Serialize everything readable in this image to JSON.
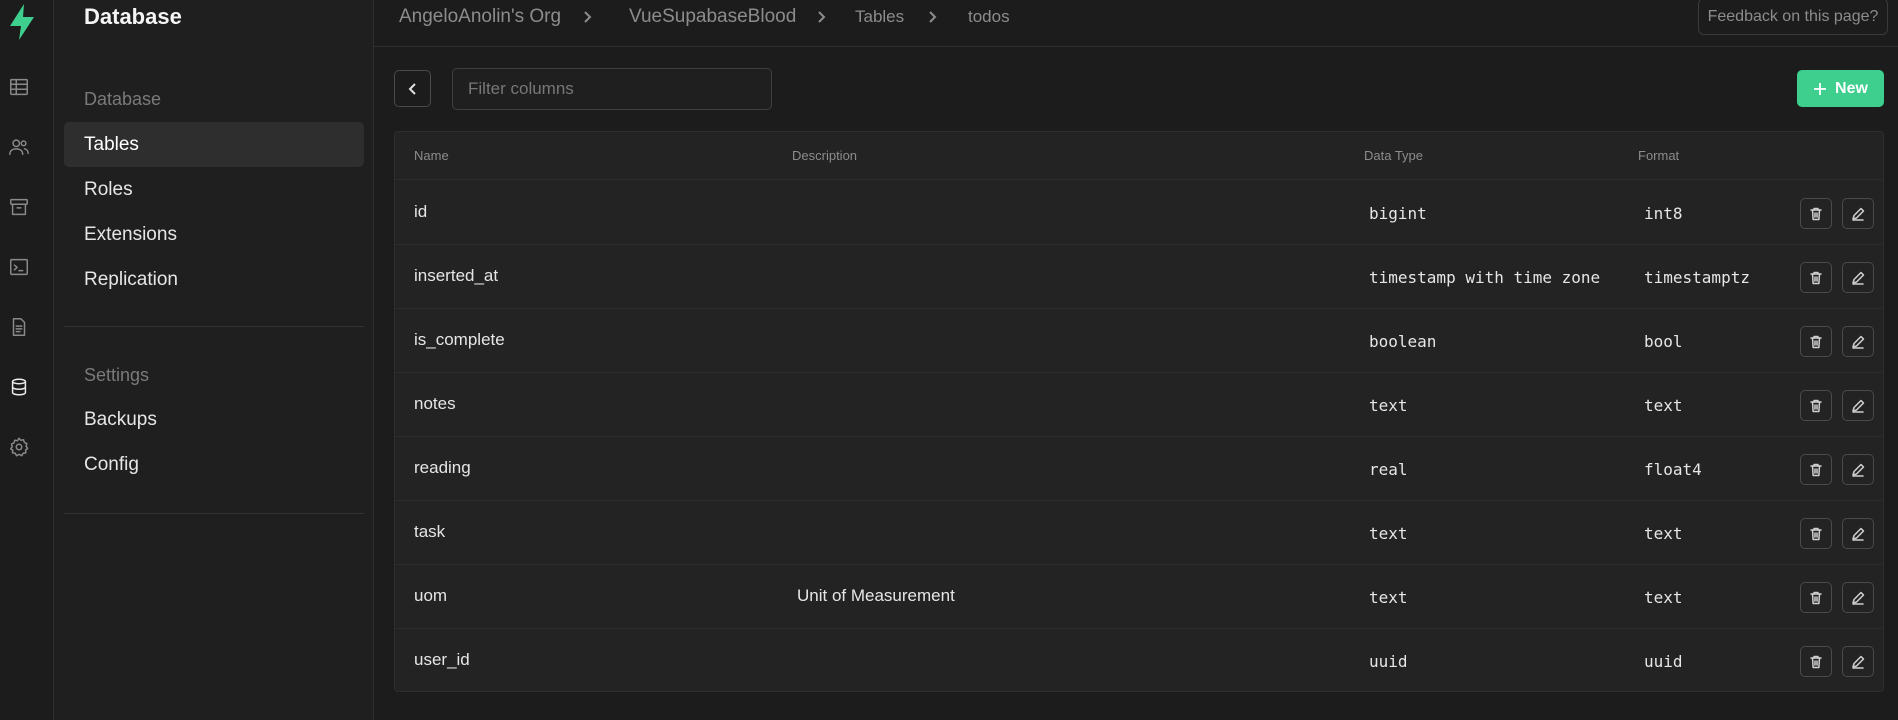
{
  "sidebar": {
    "title": "Database",
    "sections": [
      {
        "heading": "Database",
        "items": [
          "Tables",
          "Roles",
          "Extensions",
          "Replication"
        ]
      },
      {
        "heading": "Settings",
        "items": [
          "Backups",
          "Config"
        ]
      }
    ]
  },
  "breadcrumb": {
    "org": "AngeloAnolin's Org",
    "project": "VueSupabaseBlood",
    "section": "Tables",
    "table": "todos"
  },
  "feedback_label": "Feedback on this page?",
  "toolbar": {
    "filter_placeholder": "Filter columns",
    "new_label": "New"
  },
  "table": {
    "headers": [
      "Name",
      "Description",
      "Data Type",
      "Format"
    ],
    "rows": [
      {
        "name": "id",
        "description": "",
        "type": "bigint",
        "format": "int8"
      },
      {
        "name": "inserted_at",
        "description": "",
        "type": "timestamp with time zone",
        "format": "timestamptz"
      },
      {
        "name": "is_complete",
        "description": "",
        "type": "boolean",
        "format": "bool"
      },
      {
        "name": "notes",
        "description": "",
        "type": "text",
        "format": "text"
      },
      {
        "name": "reading",
        "description": "",
        "type": "real",
        "format": "float4"
      },
      {
        "name": "task",
        "description": "",
        "type": "text",
        "format": "text"
      },
      {
        "name": "uom",
        "description": "Unit of Measurement",
        "type": "text",
        "format": "text"
      },
      {
        "name": "user_id",
        "description": "",
        "type": "uuid",
        "format": "uuid"
      }
    ]
  },
  "colors": {
    "brand": "#3ecf8e",
    "background": "#1c1c1c",
    "panel": "#232323"
  }
}
